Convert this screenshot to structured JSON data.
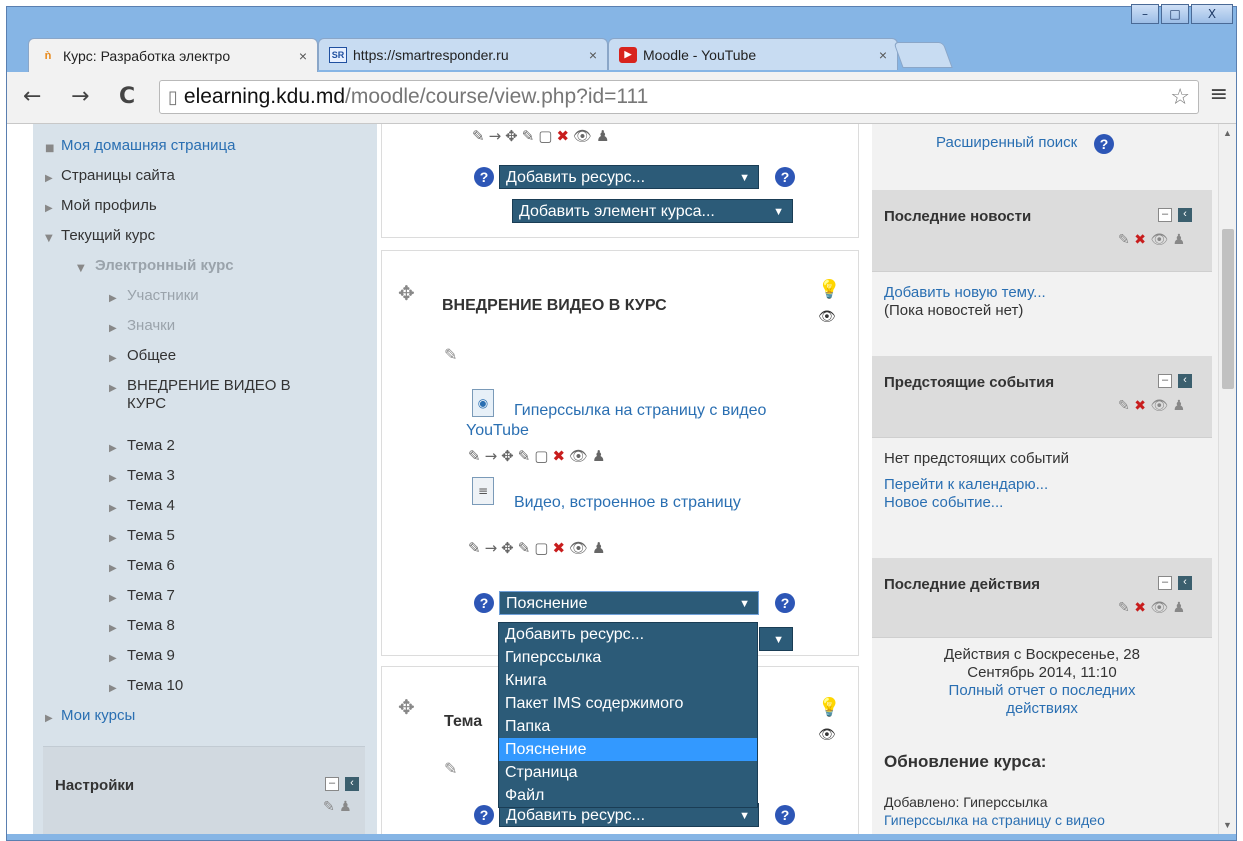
{
  "window": {
    "controls": [
      "–",
      "□",
      "X"
    ]
  },
  "tabs": [
    {
      "icon": "moodle-favicon",
      "favicon_text": "ǹ",
      "label": "Курс: Разработка электро",
      "close": "×"
    },
    {
      "icon": "smartresponder-favicon",
      "favicon_text": "SR",
      "label": "https://smartresponder.ru",
      "close": "×"
    },
    {
      "icon": "youtube-favicon",
      "favicon_text": "▶",
      "label": "Moodle - YouTube",
      "close": "×"
    }
  ],
  "toolbar": {
    "back": "←",
    "forward": "→",
    "reload": "C",
    "url_host": "elearning.kdu.md",
    "url_path": "/moodle/course/view.php?id=111",
    "star": "☆",
    "menu": "≡"
  },
  "navigation": {
    "items": [
      {
        "label": "Моя домашняя страница",
        "link": true
      },
      {
        "label": "Страницы сайта",
        "link": false
      },
      {
        "label": "Мой профиль",
        "link": false
      },
      {
        "label": "Текущий курс",
        "link": false
      },
      {
        "label": "Электронный курс",
        "link": false
      },
      {
        "label": "Участники",
        "link": false
      },
      {
        "label": "Значки",
        "link": false
      },
      {
        "label": "Общее",
        "link": false
      },
      {
        "label": "ВНЕДРЕНИЕ ВИДЕО В КУРС",
        "link": false
      },
      {
        "label": "Тема 2",
        "link": false
      },
      {
        "label": "Тема 3",
        "link": false
      },
      {
        "label": "Тема 4",
        "link": false
      },
      {
        "label": "Тема 5",
        "link": false
      },
      {
        "label": "Тема 6",
        "link": false
      },
      {
        "label": "Тема 7",
        "link": false
      },
      {
        "label": "Тема 8",
        "link": false
      },
      {
        "label": "Тема 9",
        "link": false
      },
      {
        "label": "Тема 10",
        "link": false
      },
      {
        "label": "Мои курсы",
        "link": true
      }
    ],
    "settings_title": "Настройки"
  },
  "course": {
    "top_section": {
      "add_resource": "Добавить ресурс...",
      "add_activity": "Добавить элемент курса..."
    },
    "video_section": {
      "title": "ВНЕДРЕНИЕ ВИДЕО В КУРС",
      "item1": "Гиперссылка на страницу с видео YouTube",
      "item2": "Видео, встроенное в страницу",
      "select_value": "Пояснение",
      "options": [
        "Добавить ресурс...",
        "Гиперссылка",
        "Книга",
        "Пакет IMS содержимого",
        "Папка",
        "Пояснение",
        "Страница",
        "Файл"
      ],
      "selected_option": "Пояснение"
    },
    "next_section": {
      "title": "Тема",
      "add_resource": "Добавить ресурс..."
    }
  },
  "right": {
    "advanced_search": "Расширенный поиск",
    "news": {
      "title": "Последние новости",
      "add_topic": "Добавить новую тему...",
      "empty": "(Пока новостей нет)"
    },
    "events": {
      "title": "Предстоящие события",
      "empty": "Нет предстоящих событий",
      "calendar": "Перейти к календарю...",
      "new_event": "Новое событие..."
    },
    "activity": {
      "title": "Последние действия",
      "since_line1": "Действия с Воскресенье, 28",
      "since_line2": "Сентябрь 2014, 11:10",
      "full_report": "Полный отчет о последних действиях",
      "course_updates": "Обновление курса:",
      "added": "Добавлено: Гиперссылка",
      "added_link": "Гиперссылка на страницу с видео"
    }
  },
  "colors": {
    "frame": "#86b5e5",
    "select_bg": "#2c5b78",
    "highlight": "#3399ff",
    "link": "#2a6fb2",
    "left_bg": "#d8e2ea",
    "delete": "#c81d1d"
  }
}
